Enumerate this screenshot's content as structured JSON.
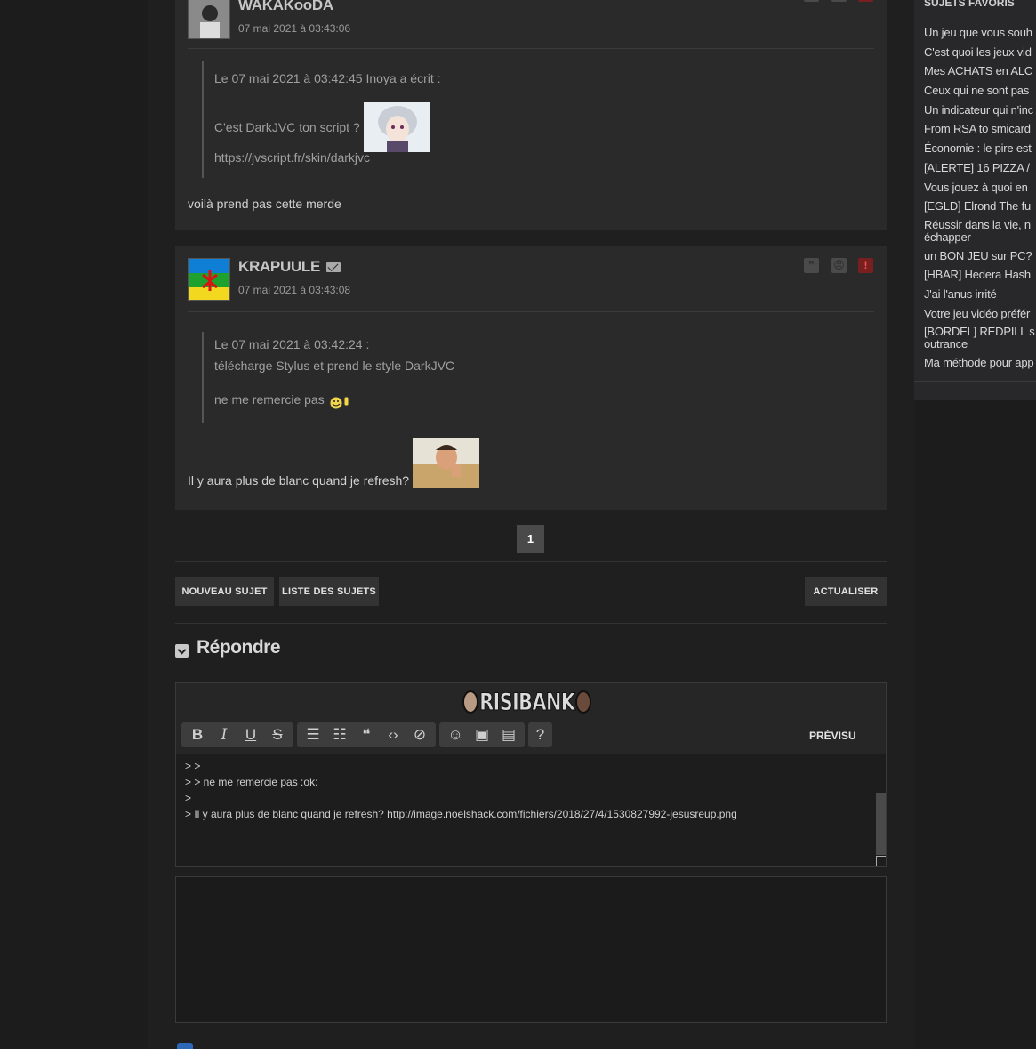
{
  "posts": [
    {
      "author": "WAKAKooDA",
      "date": "07 mai 2021 à 03:43:06",
      "quote_header": "Le 07 mai 2021 à 03:42:45 Inoya a écrit :",
      "quote_line1": "C'est DarkJVC ton script ?",
      "quote_line2": "https://jvscript.fr/skin/darkjvc",
      "message": "voilà prend pas cette merde"
    },
    {
      "author": "KRAPUULE",
      "date": "07 mai 2021 à 03:43:08",
      "quote_header": "Le 07 mai 2021 à 03:42:24 :",
      "quote_line1": "télécharge Stylus et prend le style DarkJVC",
      "quote_line2": "ne me remercie pas",
      "message": "Il y aura plus de blanc quand je refresh?"
    }
  ],
  "pagination": {
    "current": "1"
  },
  "buttons": {
    "new_topic": "NOUVEAU SUJET",
    "topic_list": "LISTE DES SUJETS",
    "refresh": "ACTUALISER"
  },
  "reply": {
    "title": "Répondre",
    "risibank_label": "RISIBANK",
    "preview_label": "PRÉVISU",
    "toolbar": {
      "bold": "B",
      "italic": "I",
      "underline": "U",
      "strike": "S",
      "list_ul": "☰",
      "list_ol": "☷",
      "quote": "❝",
      "code": "‹›",
      "spoiler": "⊘",
      "smiley": "☺",
      "image": "▣",
      "video": "▤",
      "help": "?"
    },
    "textarea_lines": [
      "> >",
      "> > ne me remercie pas :ok:",
      ">",
      "> Il y aura plus de blanc quand je refresh?  http://image.noelshack.com/fichiers/2018/27/4/1530827992-jesusreup.png"
    ]
  },
  "sidebar": {
    "title": "SUJETS FAVORIS",
    "items": [
      "Un jeu que vous souh",
      "C'est quoi les jeux vid",
      "Mes ACHATS en ALC",
      "Ceux qui ne sont pas",
      "Un indicateur qui n'inc",
      "From RSA to smicard",
      "Économie : le pire est",
      "[ALERTE] 16 PIZZA /",
      "Vous jouez à quoi en",
      "[EGLD] Elrond The fu",
      "Réussir dans la vie, n échapper",
      "un BON JEU sur PC?",
      "[HBAR] Hedera Hash",
      "J'ai l'anus irrité",
      "Votre jeu vidéo préfér",
      "[BORDEL] REDPILL s outrance",
      "Ma méthode pour app"
    ]
  },
  "colors": {
    "background": "#1f1f20",
    "post_bg": "#2a2a2b",
    "alert": "#7a1f1f",
    "footer_icon": "#2d68b8"
  }
}
